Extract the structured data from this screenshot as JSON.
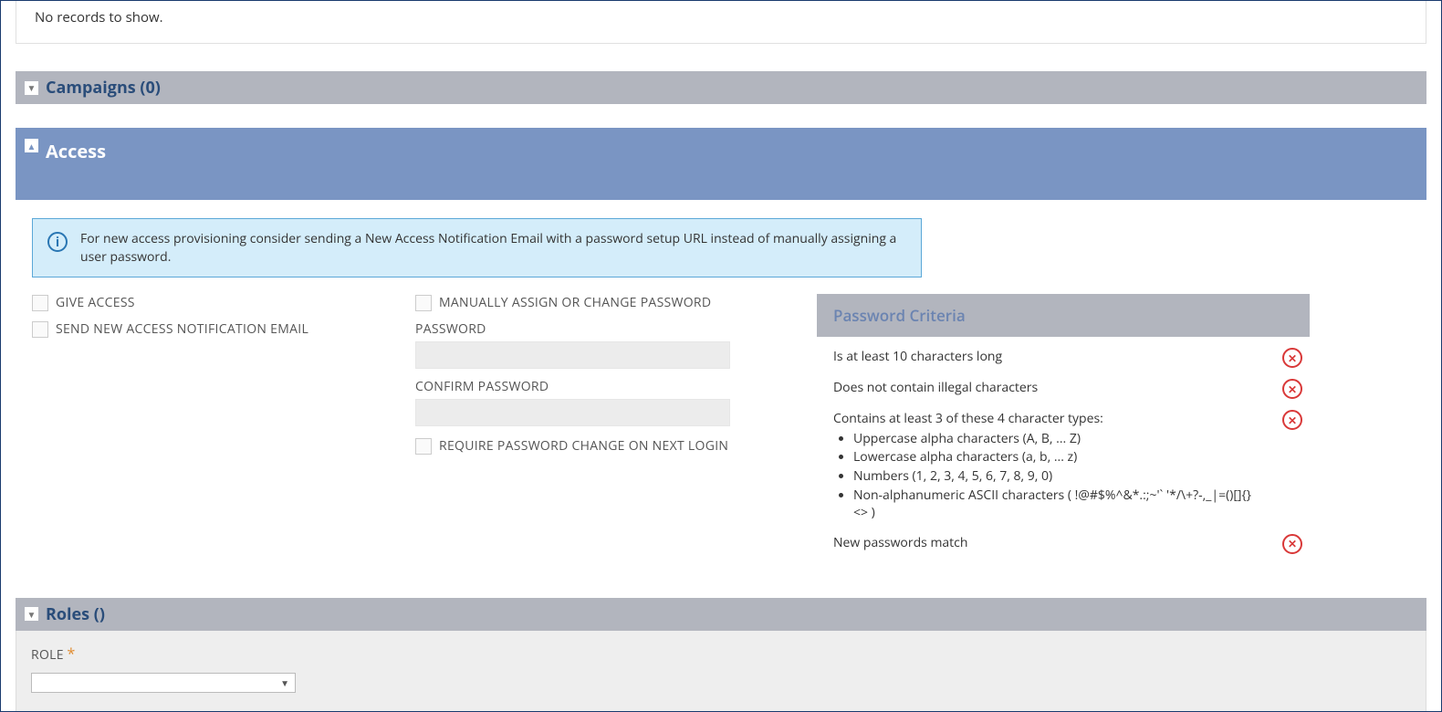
{
  "records": {
    "empty_text": "No records to show."
  },
  "campaigns": {
    "title": "Campaigns (0)"
  },
  "access": {
    "title": "Access",
    "info_text": "For new access provisioning consider sending a New Access Notification Email with a password setup URL instead of manually assigning a user password.",
    "give_access_label": "GIVE ACCESS",
    "send_email_label": "SEND NEW ACCESS NOTIFICATION EMAIL",
    "manual_assign_label": "MANUALLY ASSIGN OR CHANGE PASSWORD",
    "password_label": "PASSWORD",
    "confirm_password_label": "CONFIRM PASSWORD",
    "require_change_label": "REQUIRE PASSWORD CHANGE ON NEXT LOGIN"
  },
  "criteria": {
    "header": "Password Criteria",
    "c1": "Is at least 10 characters long",
    "c2": "Does not contain illegal characters",
    "c3": "Contains at least 3 of these 4 character types:",
    "c3a": "Uppercase alpha characters (A, B, ... Z)",
    "c3b": "Lowercase alpha characters (a, b, ... z)",
    "c3c": "Numbers (1, 2, 3, 4, 5, 6, 7, 8, 9, 0)",
    "c3d": "Non-alphanumeric ASCII characters ( !@#$%^&*.:;~'` '*/\\+?-,_|=()[]{}<> )",
    "c4": "New passwords match"
  },
  "roles": {
    "title": "Roles ()",
    "role_label": "ROLE"
  }
}
